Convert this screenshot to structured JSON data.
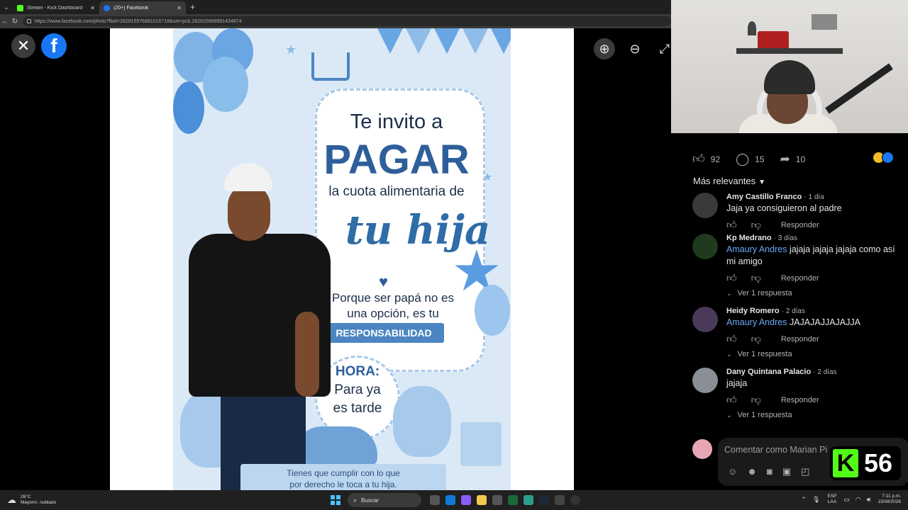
{
  "browser": {
    "tabs": [
      {
        "label": "Stream - Kick Dashboard",
        "favicon": "kick-icon",
        "active": false
      },
      {
        "label": "(20+) Facebook",
        "favicon": "facebook-icon",
        "active": true
      }
    ],
    "url": "https://www.facebook.com/photo?fbid=282815976881016718&set=pcb.282815989991434874"
  },
  "flyer": {
    "invite": "Te invito a",
    "pagar": "PAGAR",
    "cuota": "la cuota alimentaria de",
    "hija": "tu hija",
    "porque_1": "Porque ser papá no es",
    "porque_2": "una opción, es tu",
    "responsabilidad": "RESPONSABILIDAD",
    "hora_title": "HORA:",
    "hora_1": "Para ya",
    "hora_2": "es tarde",
    "tienes_1": "Tienes que cumplir con lo que",
    "tienes_2": "por derecho le toca a tu hija."
  },
  "post": {
    "likes": "92",
    "comments": "15",
    "shares": "10",
    "sort_label": "Más relevantes"
  },
  "comments": [
    {
      "name": "Amy Castillo Franco",
      "time": "1 día",
      "mention": "",
      "text": "Jaja ya consiguieron al padre",
      "reply_label": "Responder",
      "replies": ""
    },
    {
      "name": "Kp Medrano",
      "time": "3 días",
      "mention": "Amaury Andres",
      "text": " jajaja jajaja jajaja como así mi amigo",
      "reply_label": "Responder",
      "replies": "Ver 1 respuesta"
    },
    {
      "name": "Heidy Romero",
      "time": "2 días",
      "mention": "Amaury Andres",
      "text": " JAJAJAJJAJAJJA",
      "reply_label": "Responder",
      "replies": "Ver 1 respuesta"
    },
    {
      "name": "Dany Quintana Palacio",
      "time": "2 días",
      "mention": "",
      "text": "jajaja",
      "reply_label": "Responder",
      "replies": "Ver 1 respuesta"
    }
  ],
  "composer": {
    "placeholder": "Comentar como Marian Pi"
  },
  "kick_badge": {
    "count": "56",
    "letter": "K"
  },
  "taskbar": {
    "weather_temp": "26°C",
    "weather_desc": "Mayorm. nublado",
    "search_label": "Buscar",
    "lang_1": "ESP",
    "lang_2": "LAA",
    "time": "7:11 p.m.",
    "date": "15/08/2026"
  },
  "colors": {
    "facebook_blue": "#1877f2",
    "kick_green": "#53fc18",
    "mention_blue": "#6aa9f5"
  }
}
